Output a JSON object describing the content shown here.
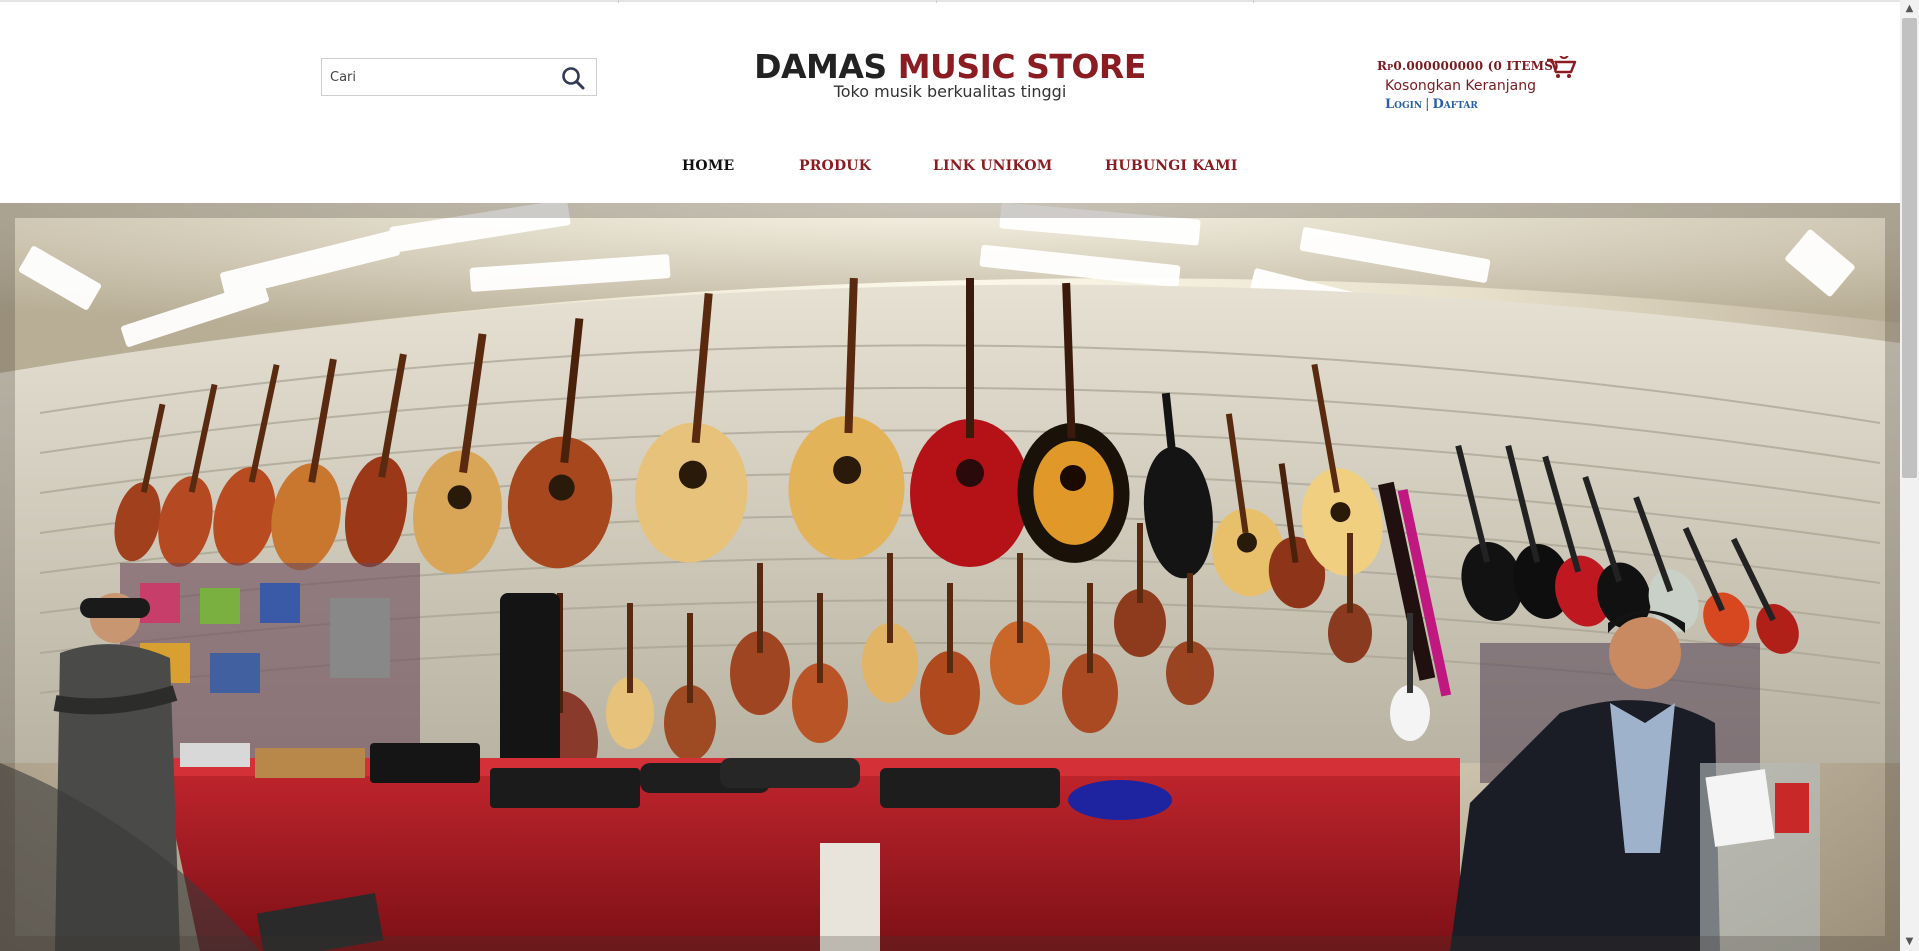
{
  "header": {
    "search": {
      "placeholder": "Cari",
      "value": "Cari"
    },
    "brand": {
      "title_dark": "DAMAS",
      "title_accent": "MUSIC STORE",
      "tagline": "Toko musik berkualitas tinggi"
    },
    "cart": {
      "total": "Rp0.000000000 (0 ITEMS)",
      "empty_label": "Kosongkan Keranjang",
      "login_label": "Login",
      "register_label": "Daftar",
      "separator": "|"
    }
  },
  "nav": {
    "items": [
      {
        "label": "HOME",
        "active": true
      },
      {
        "label": "PRODUK",
        "active": false
      },
      {
        "label": "LINK UNIKOM",
        "active": false
      },
      {
        "label": "HUBUNGI KAMI",
        "active": false
      }
    ]
  },
  "hero": {
    "alt": ""
  },
  "icons": {
    "search": "search-icon",
    "cart": "cart-icon"
  },
  "colors": {
    "accent": "#8b1c22",
    "link": "#2a5ea8",
    "text": "#222222"
  }
}
